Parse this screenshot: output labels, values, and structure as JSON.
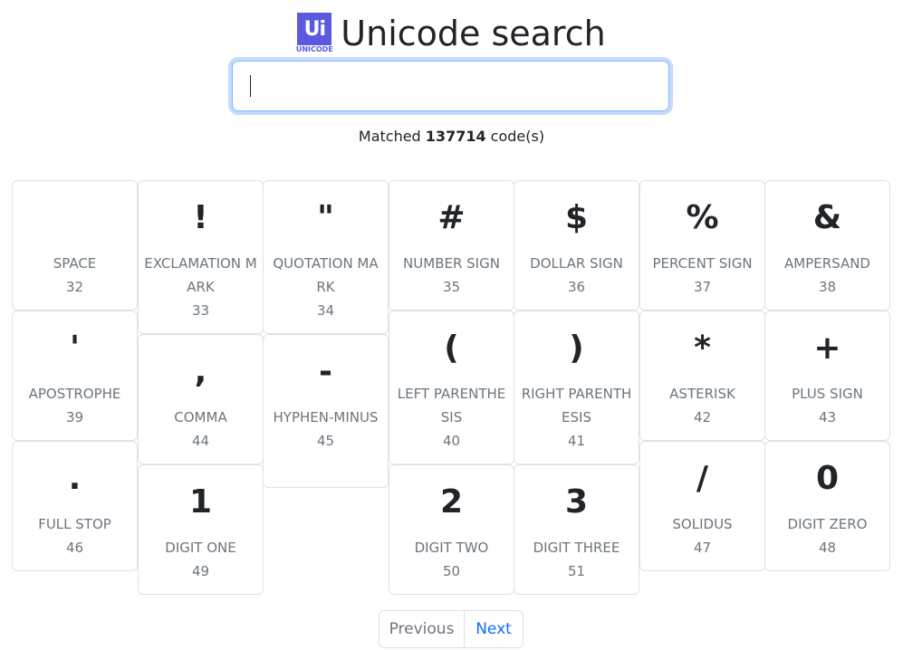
{
  "header": {
    "logo_mark": "Ui",
    "logo_text": "UNICODE",
    "title": "Unicode search"
  },
  "search": {
    "value": "",
    "placeholder": ""
  },
  "status": {
    "prefix": "Matched ",
    "count": "137714",
    "suffix": " code(s)"
  },
  "chars": [
    {
      "glyph": " ",
      "name": "SPACE",
      "code": "32"
    },
    {
      "glyph": "!",
      "name": "EXCLAMATION MARK",
      "code": "33"
    },
    {
      "glyph": "\"",
      "name": "QUOTATION MARK",
      "code": "34"
    },
    {
      "glyph": "#",
      "name": "NUMBER SIGN",
      "code": "35"
    },
    {
      "glyph": "$",
      "name": "DOLLAR SIGN",
      "code": "36"
    },
    {
      "glyph": "%",
      "name": "PERCENT SIGN",
      "code": "37"
    },
    {
      "glyph": "&",
      "name": "AMPERSAND",
      "code": "38"
    },
    {
      "glyph": "'",
      "name": "APOSTROPHE",
      "code": "39"
    },
    {
      "glyph": ",",
      "name": "COMMA",
      "code": "44"
    },
    {
      "glyph": "-",
      "name": "HYPHEN-MINUS",
      "code": "45"
    },
    {
      "glyph": "(",
      "name": "LEFT PARENTHESIS",
      "code": "40"
    },
    {
      "glyph": ")",
      "name": "RIGHT PARENTHESIS",
      "code": "41"
    },
    {
      "glyph": "*",
      "name": "ASTERISK",
      "code": "42"
    },
    {
      "glyph": "+",
      "name": "PLUS SIGN",
      "code": "43"
    },
    {
      "glyph": ".",
      "name": "FULL STOP",
      "code": "46"
    },
    {
      "glyph": "1",
      "name": "DIGIT ONE",
      "code": "49"
    },
    {
      "glyph": "2",
      "name": "DIGIT TWO",
      "code": "50"
    },
    {
      "glyph": "3",
      "name": "DIGIT THREE",
      "code": "51"
    },
    {
      "glyph": "/",
      "name": "SOLIDUS",
      "code": "47"
    },
    {
      "glyph": "0",
      "name": "DIGIT ZERO",
      "code": "48"
    }
  ],
  "pagination": {
    "previous_label": "Previous",
    "next_label": "Next"
  }
}
